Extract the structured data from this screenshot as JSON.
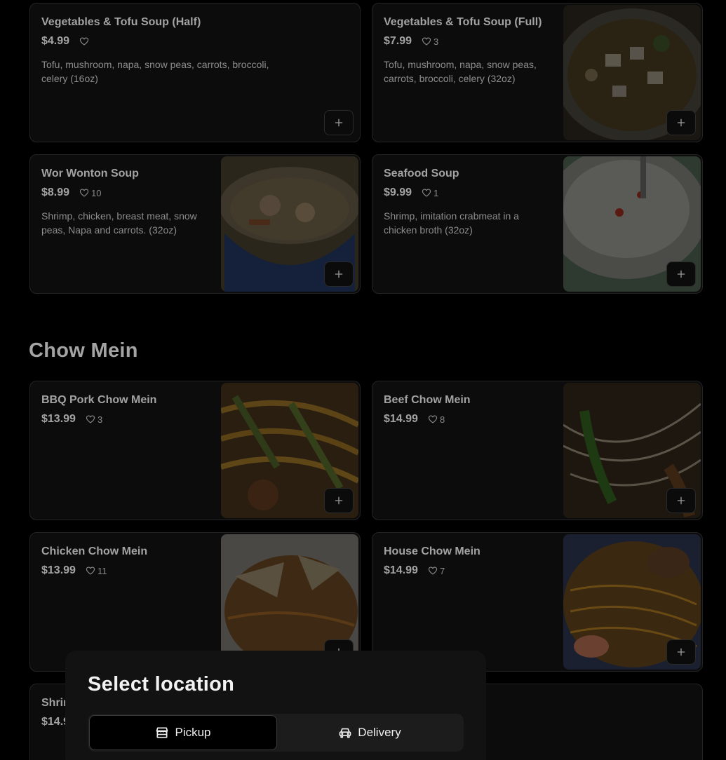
{
  "soups": [
    {
      "name": "Vegetables & Tofu Soup (Half)",
      "price": "$4.99",
      "likes": "",
      "desc": "Tofu, mushroom, napa, snow peas, carrots, broccoli, celery (16oz)"
    },
    {
      "name": "Vegetables & Tofu Soup (Full)",
      "price": "$7.99",
      "likes": "3",
      "desc": "Tofu, mushroom, napa, snow peas, carrots, broccoli, celery (32oz)"
    },
    {
      "name": "Wor Wonton Soup",
      "price": "$8.99",
      "likes": "10",
      "desc": "Shrimp, chicken, breast meat, snow peas, Napa and carrots. (32oz)"
    },
    {
      "name": "Seafood Soup",
      "price": "$9.99",
      "likes": "1",
      "desc": "Shrimp, imitation crabmeat in a chicken broth (32oz)"
    }
  ],
  "chow_mein": {
    "section_title": "Chow Mein",
    "items": [
      {
        "name": "BBQ Pork Chow Mein",
        "price": "$13.99",
        "likes": "3"
      },
      {
        "name": "Beef Chow Mein",
        "price": "$14.99",
        "likes": "8"
      },
      {
        "name": "Chicken Chow Mein",
        "price": "$13.99",
        "likes": "11"
      },
      {
        "name": "House Chow Mein",
        "price": "$14.99",
        "likes": "7"
      },
      {
        "name": "Shrim",
        "price": "$14.9"
      }
    ]
  },
  "location_panel": {
    "title": "Select location",
    "pickup_label": "Pickup",
    "delivery_label": "Delivery",
    "selected": "Pickup"
  },
  "icons": {
    "like": "heart-icon",
    "add": "plus-icon",
    "pickup": "store-icon",
    "delivery": "car-icon"
  }
}
